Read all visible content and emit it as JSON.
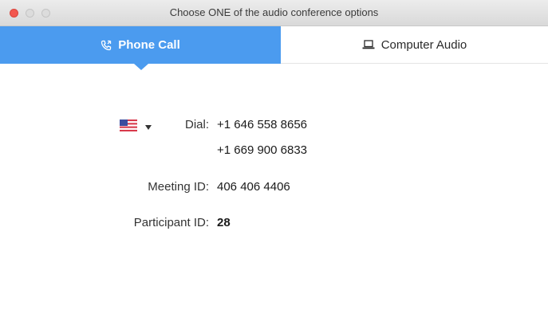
{
  "window": {
    "title": "Choose ONE of the audio conference options"
  },
  "tabs": [
    {
      "label": "Phone Call",
      "icon": "phone-icon",
      "selected": true
    },
    {
      "label": "Computer Audio",
      "icon": "laptop-icon",
      "selected": false
    }
  ],
  "dial": {
    "country_flag": "us-flag-icon",
    "label": "Dial:",
    "numbers": [
      "+1 646 558 8656",
      "+1 669 900 6833"
    ]
  },
  "meeting": {
    "label": "Meeting ID:",
    "value": "406 406 4406"
  },
  "participant": {
    "label": "Participant ID:",
    "value": "28"
  },
  "colors": {
    "accent": "#4b9bef",
    "close_button": "#f2574f"
  }
}
